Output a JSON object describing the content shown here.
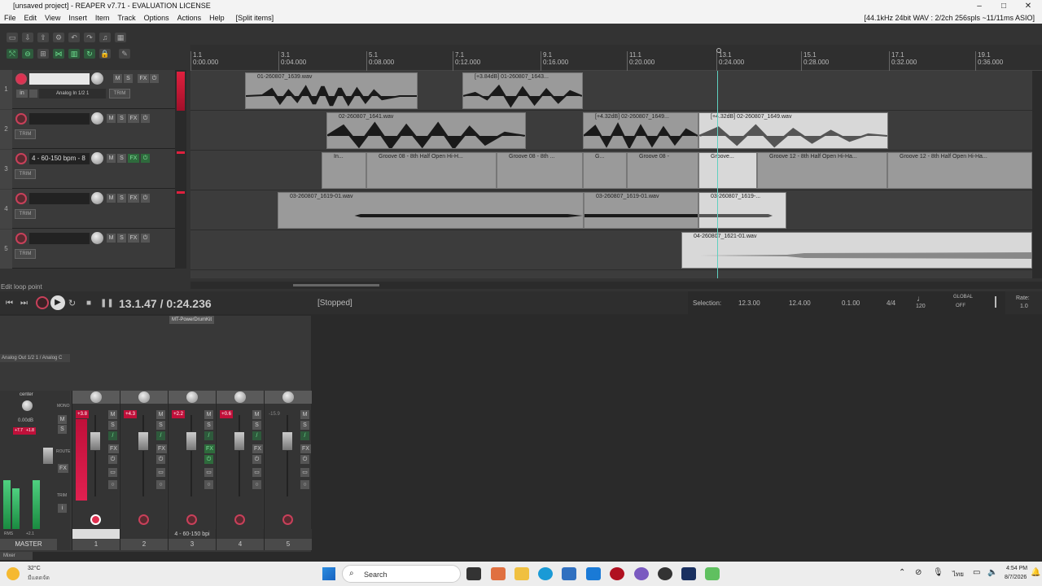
{
  "window": {
    "title": "[unsaved project] - REAPER v7.71 - EVALUATION LICENSE"
  },
  "menu": {
    "items": [
      "File",
      "Edit",
      "View",
      "Insert",
      "Item",
      "Track",
      "Options",
      "Actions",
      "Help",
      "[Split items]"
    ],
    "status": "[44.1kHz 24bit WAV : 2/2ch 256spls ~11/11ms ASIO]"
  },
  "ruler": {
    "marks": [
      {
        "bar": "1.1",
        "time": "0:00.000"
      },
      {
        "bar": "3.1",
        "time": "0:04.000"
      },
      {
        "bar": "5.1",
        "time": "0:08.000"
      },
      {
        "bar": "7.1",
        "time": "0:12.000"
      },
      {
        "bar": "9.1",
        "time": "0:16.000"
      },
      {
        "bar": "11.1",
        "time": "0:20.000"
      },
      {
        "bar": "13.1",
        "time": "0:24.000"
      },
      {
        "bar": "15.1",
        "time": "0:28.000"
      },
      {
        "bar": "17.1",
        "time": "0:32.000"
      },
      {
        "bar": "19.1",
        "time": "0:36.000"
      }
    ]
  },
  "tracks": [
    {
      "num": "1",
      "name": "",
      "input": "in",
      "input_route": "Analog In 1/2 1",
      "trim": "TRIM",
      "armed": true
    },
    {
      "num": "2",
      "name": "",
      "trim": "TRIM",
      "armed": false
    },
    {
      "num": "3",
      "name": "4 - 60-150 bpm - 8",
      "trim": "TRIM",
      "armed": false
    },
    {
      "num": "4",
      "name": "",
      "trim": "TRIM",
      "armed": false
    },
    {
      "num": "5",
      "name": "",
      "trim": "TRIM",
      "armed": false
    }
  ],
  "items": [
    {
      "lane": 0,
      "label": "01-260807_1639.wav"
    },
    {
      "lane": 0,
      "label": "[+3.84dB] 01-260807_1643..."
    },
    {
      "lane": 1,
      "label": "02-260807_1641.wav"
    },
    {
      "lane": 1,
      "label": "[+4.32dB] 02-260807_1649..."
    },
    {
      "lane": 1,
      "label": "[+4.32dB] 02-260807_1649.wav"
    },
    {
      "lane": 2,
      "label": "In..."
    },
    {
      "lane": 2,
      "label": "Groove 08 - 8th Half Open Hi-H..."
    },
    {
      "lane": 2,
      "label": "Groove 08 - 8th ..."
    },
    {
      "lane": 2,
      "label": "G..."
    },
    {
      "lane": 2,
      "label": "Groove 08 -"
    },
    {
      "lane": 2,
      "label": "Groove..."
    },
    {
      "lane": 2,
      "label": "Groove 12 - 8th Half Open Hi-Ha..."
    },
    {
      "lane": 2,
      "label": "Groove 12 - 8th Half Open Hi-Ha..."
    },
    {
      "lane": 3,
      "label": "03-260807_1619-01.wav"
    },
    {
      "lane": 3,
      "label": "03-260807_1619-01.wav"
    },
    {
      "lane": 3,
      "label": "03-260807_1619-..."
    },
    {
      "lane": 4,
      "label": "04-260807_1621-01.wav"
    }
  ],
  "status_line": "Edit loop point",
  "transport": {
    "position": "13.1.47 / 0:24.236",
    "state": "[Stopped]",
    "selection_label": "Selection:",
    "sel_start": "12.3.00",
    "sel_end": "12.4.00",
    "sel_len": "0.1.00",
    "timesig": "4/4",
    "bpm": "120",
    "global_label": "GLOBAL",
    "global_state": "OFF",
    "rate_label": "Rate:",
    "rate": "1.0"
  },
  "mixer": {
    "fx_plugin": "MT-PowerDrumKit",
    "master_route": "Analog Out 1/2 1 / Analog C",
    "master": {
      "pan": "center",
      "vol": "0.00dB",
      "label": "MASTER",
      "peak_l": "+7.7",
      "peak_r": "+1.8",
      "rms_label": "RMS",
      "rms": "+2.1",
      "mono": "MONO",
      "route": "ROUTE",
      "trim": "TRIM"
    },
    "channels": [
      {
        "num": "1",
        "peak": "+3.8",
        "name": ""
      },
      {
        "num": "2",
        "peak": "+4.3",
        "name": ""
      },
      {
        "num": "3",
        "peak": "+2.2",
        "name": "4 - 60-150 bpi"
      },
      {
        "num": "4",
        "peak": "+0.6",
        "name": ""
      },
      {
        "num": "5",
        "peak": "-15.9",
        "name": ""
      }
    ],
    "tab": "Mixer"
  },
  "taskbar": {
    "weather_temp": "32°C",
    "weather_desc": "มีแดดจัด",
    "search": "Search",
    "time": "4:54 PM",
    "date": "8/7/2026",
    "lang": "ไทย"
  }
}
